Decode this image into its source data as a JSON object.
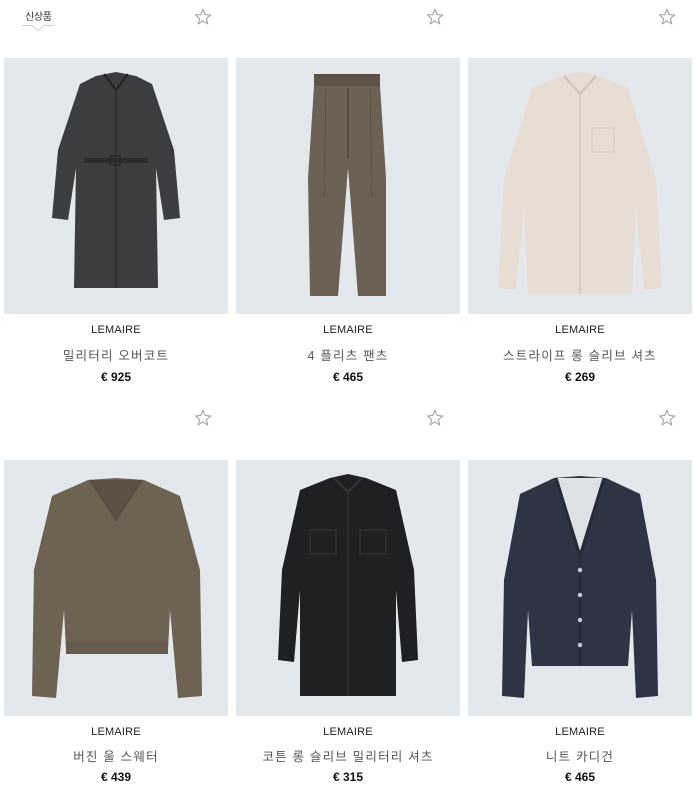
{
  "badge": {
    "label": "신상품"
  },
  "products": [
    {
      "brand": "LEMAIRE",
      "name": "밀리터리 오버코트",
      "price": "€ 925",
      "icon": "star-icon"
    },
    {
      "brand": "LEMAIRE",
      "name": "4 플리츠 팬츠",
      "price": "€ 465",
      "icon": "star-icon"
    },
    {
      "brand": "LEMAIRE",
      "name": "스트라이프 롱 슬리브 셔츠",
      "price": "€ 269",
      "icon": "star-icon"
    },
    {
      "brand": "LEMAIRE",
      "name": "버진 울 스웨터",
      "price": "€ 439",
      "icon": "star-icon"
    },
    {
      "brand": "LEMAIRE",
      "name": "코튼 롱 슬리브 밀리터리 셔츠",
      "price": "€ 315",
      "icon": "star-icon"
    },
    {
      "brand": "LEMAIRE",
      "name": "니트 카디건",
      "price": "€ 465",
      "icon": "star-icon"
    }
  ],
  "colors": {
    "photo_bg": "#e3e8ec",
    "price": "#111111",
    "name": "#555555"
  }
}
